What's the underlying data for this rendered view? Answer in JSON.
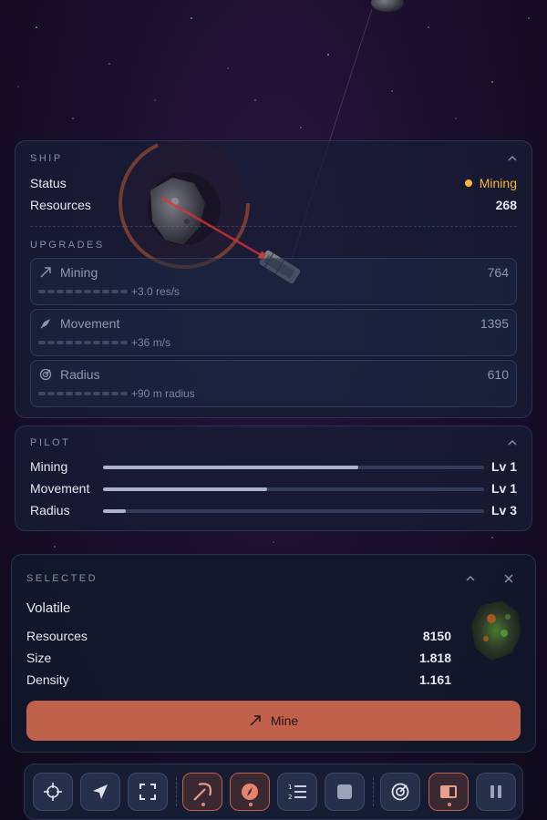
{
  "ship": {
    "section_title": "SHIP",
    "status_label": "Status",
    "status_value": "Mining",
    "resources_label": "Resources",
    "resources_value": "268",
    "upgrades_title": "UPGRADES",
    "upgrades": [
      {
        "name": "Mining",
        "cost": "764",
        "bonus": "+3.0 res/s",
        "icon": "pickaxe-arrow-icon"
      },
      {
        "name": "Movement",
        "cost": "1395",
        "bonus": "+36 m/s",
        "icon": "rocket-icon"
      },
      {
        "name": "Radius",
        "cost": "610",
        "bonus": "+90 m radius",
        "icon": "radar-icon"
      }
    ]
  },
  "pilot": {
    "section_title": "PILOT",
    "skills": [
      {
        "name": "Mining",
        "level": "Lv 1",
        "progress": 0.67
      },
      {
        "name": "Movement",
        "level": "Lv 1",
        "progress": 0.43
      },
      {
        "name": "Radius",
        "level": "Lv 3",
        "progress": 0.06
      }
    ]
  },
  "selected": {
    "section_title": "SELECTED",
    "name": "Volatile",
    "rows": [
      {
        "label": "Resources",
        "value": "8150"
      },
      {
        "label": "Size",
        "value": "1.818"
      },
      {
        "label": "Density",
        "value": "1.161"
      }
    ],
    "mine_label": "Mine"
  },
  "toolbar": {
    "buttons": [
      {
        "name": "center-target",
        "icon": "crosshair-icon",
        "active": false
      },
      {
        "name": "navigate",
        "icon": "navigation-arrow-icon",
        "active": false
      },
      {
        "name": "fullscreen",
        "icon": "fullscreen-icon",
        "active": false
      },
      {
        "name": "mine",
        "icon": "pickaxe-icon",
        "active": true
      },
      {
        "name": "explore",
        "icon": "compass-icon",
        "active": true
      },
      {
        "name": "queue",
        "icon": "numbered-list-icon",
        "active": false
      },
      {
        "name": "stop",
        "icon": "stop-icon",
        "active": false
      },
      {
        "name": "scan",
        "icon": "radar-icon",
        "active": false
      },
      {
        "name": "panel",
        "icon": "panel-icon",
        "active": true
      },
      {
        "name": "pause",
        "icon": "pause-icon",
        "active": false
      }
    ]
  },
  "colors": {
    "accent": "#c0614c",
    "status": "#f5b935",
    "panel": "#161e34"
  }
}
